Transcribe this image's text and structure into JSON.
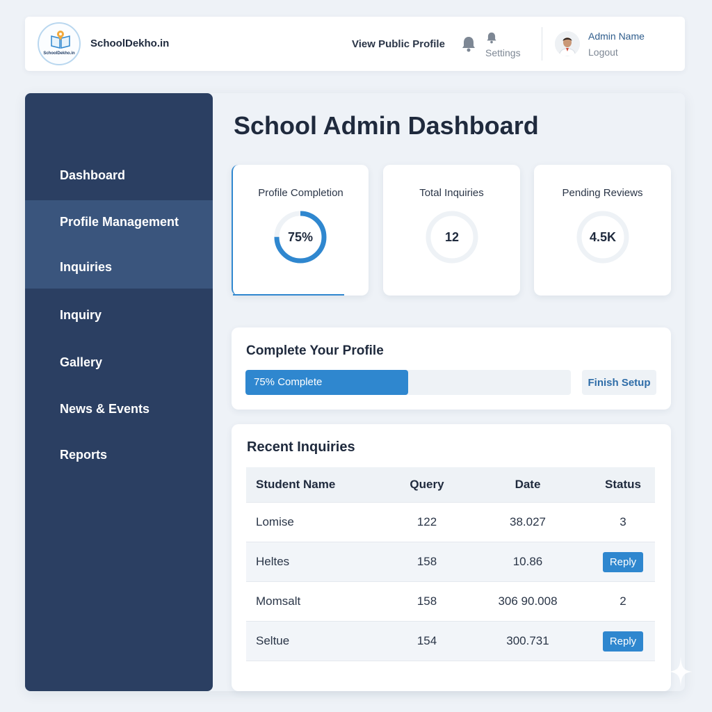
{
  "header": {
    "logo_text": "SchoolDekho.in",
    "brand": "SchoolDekho.in",
    "public_profile_link": "View Public Profile",
    "settings_label": "Settings",
    "user_name": "Admin Name",
    "logout_label": "Logout"
  },
  "sidebar": {
    "items": [
      {
        "label": "Dashboard"
      },
      {
        "label": "Profile Management"
      },
      {
        "label": "Inquiries"
      },
      {
        "label": "Inquiry"
      },
      {
        "label": "Gallery"
      },
      {
        "label": "News & Events"
      },
      {
        "label": "Reports"
      }
    ],
    "active_items": [
      "Profile Management",
      "Inquiries"
    ]
  },
  "main": {
    "title": "School Admin Dashboard",
    "stats": [
      {
        "label": "Profile Completion",
        "value": "75%",
        "progress": 0.75
      },
      {
        "label": "Total Inquiries",
        "value": "12"
      },
      {
        "label": "Pending Reviews",
        "value": "4.5K"
      }
    ],
    "complete_profile": {
      "title": "Complete Your Profile",
      "progress_text": "75% Complete",
      "progress": 0.5,
      "button_label": "Finish Setup"
    },
    "recent_inquiries": {
      "title": "Recent Inquiries",
      "columns": [
        "Student Name",
        "Query",
        "Date",
        "Status"
      ],
      "rows": [
        {
          "name": "Lomise",
          "query": "122",
          "date": "38.027",
          "status": "3",
          "status_is_button": false
        },
        {
          "name": "Heltes",
          "query": "158",
          "date": "10.86",
          "status": "Reply",
          "status_is_button": true
        },
        {
          "name": "Momsalt",
          "query": "158",
          "date": "306 90.008",
          "status": "2",
          "status_is_button": false
        },
        {
          "name": "Seltue",
          "query": "154",
          "date": "300.731",
          "status": "Reply",
          "status_is_button": true
        }
      ]
    }
  },
  "colors": {
    "sidebar_bg": "#2b3f62",
    "sidebar_active_bg": "#3a557d",
    "accent": "#2f87cf",
    "page_bg": "#eef2f7"
  }
}
